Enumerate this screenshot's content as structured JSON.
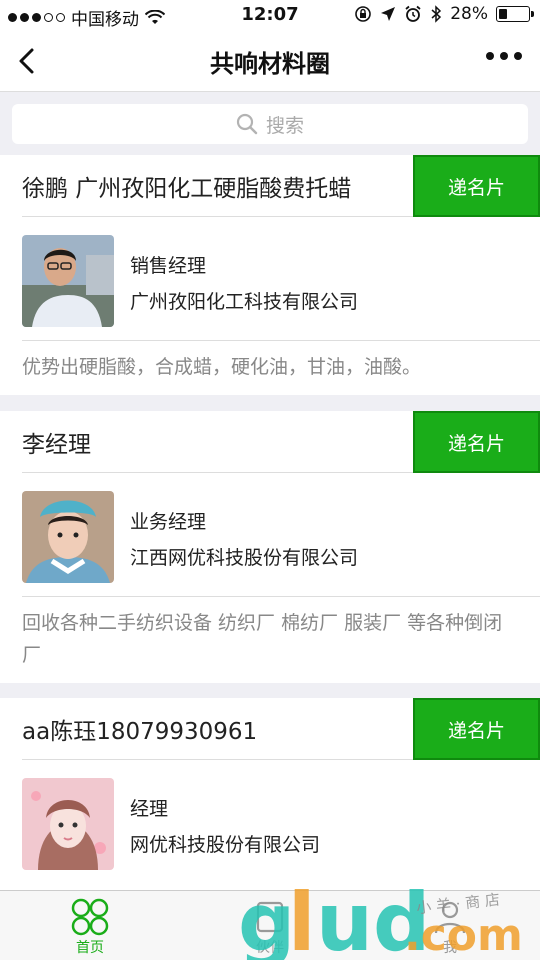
{
  "status_bar": {
    "carrier": "中国移动",
    "time": "12:07",
    "battery": "28%",
    "battery_level": 0.28
  },
  "navbar": {
    "title": "共响材料圈"
  },
  "search": {
    "placeholder": "搜索"
  },
  "cards": [
    {
      "name": "徐鹏 广州孜阳化工硬脂酸费托蜡",
      "button": "递名片",
      "position": "销售经理",
      "company": "广州孜阳化工科技有限公司",
      "description": "优势出硬脂酸，合成蜡，硬化油，甘油，油酸。"
    },
    {
      "name": "李经理",
      "button": "递名片",
      "position": "业务经理",
      "company": "江西网优科技股份有限公司",
      "description": "回收各种二手纺织设备 纺织厂 棉纺厂 服装厂 等各种倒闭厂"
    },
    {
      "name": "aa陈珏18079930961",
      "button": "递名片",
      "position": "经理",
      "company": "网优科技股份有限公司",
      "description": ""
    }
  ],
  "tabbar": {
    "items": [
      {
        "label": "首页",
        "icon": "home-circles-icon",
        "active": true
      },
      {
        "label": "伙伴",
        "icon": "partners-icon",
        "active": false
      },
      {
        "label": "我",
        "icon": "profile-icon",
        "active": false
      }
    ]
  },
  "watermark": {
    "text": "glud.com",
    "subtext": "小羊·商店"
  },
  "colors": {
    "accent": "#1aad19",
    "background": "#efeff4"
  }
}
